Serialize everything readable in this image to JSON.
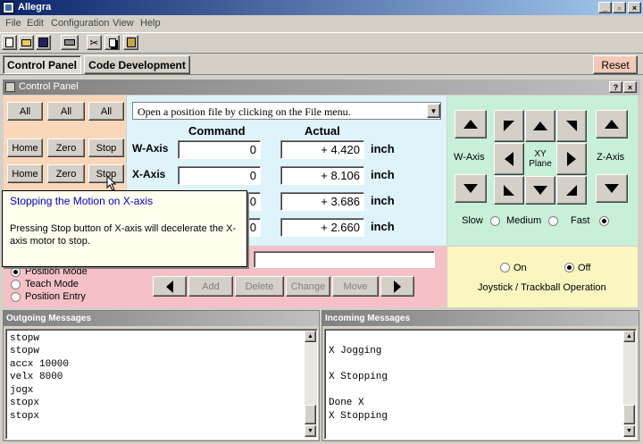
{
  "app": {
    "title": "Allegra"
  },
  "menu": [
    "File",
    "Edit",
    "Configuration",
    "View",
    "Help"
  ],
  "tabs": {
    "control_panel": "Control Panel",
    "code_development": "Code Development",
    "reset": "Reset"
  },
  "window": {
    "title": "Control Panel",
    "help": "?",
    "close": "×"
  },
  "left": {
    "all_buttons": [
      "All",
      "All",
      "All"
    ],
    "row1": [
      "Home",
      "Zero",
      "Stop"
    ],
    "row2": [
      "Home",
      "Zero",
      "Stop"
    ]
  },
  "center": {
    "dropdown_text": "Open a position file by clicking on the File menu.",
    "col_command": "Command",
    "col_actual": "Actual",
    "axes": [
      {
        "label": "W-Axis",
        "command": "0",
        "actual": "+ 4.420",
        "unit": "inch"
      },
      {
        "label": "X-Axis",
        "command": "0",
        "actual": "+ 8.106",
        "unit": "inch"
      },
      {
        "label": "",
        "command": "0",
        "actual": "+ 3.686",
        "unit": "inch"
      },
      {
        "label": "",
        "command": "0",
        "actual": "+ 2.660",
        "unit": "inch"
      }
    ]
  },
  "tooltip": {
    "title": "Stopping the Motion on X-axis",
    "body": "Pressing Stop button of X-axis will decelerate the X-axis motor to stop."
  },
  "modes": [
    "Position Mode",
    "Teach Mode",
    "Position Entry"
  ],
  "edit_buttons": [
    "Add",
    "Delete",
    "Change",
    "Move"
  ],
  "jog": {
    "w_axis": "W-Axis",
    "z_axis": "Z-Axis",
    "xy_plane": "XY\nPlane",
    "speeds": [
      {
        "label": "Slow",
        "selected": false
      },
      {
        "label": "Medium",
        "selected": false
      },
      {
        "label": "Fast",
        "selected": true
      }
    ]
  },
  "joystick": {
    "on": "On",
    "off": "Off",
    "off_selected": true,
    "caption": "Joystick / Trackball Operation"
  },
  "outgoing": {
    "title": "Outgoing Messages",
    "lines": [
      "stopw",
      "stopw",
      "accx 10000",
      "velx 8000",
      "jogx",
      "stopx",
      "stopx"
    ]
  },
  "incoming": {
    "title": "Incoming Messages",
    "lines": [
      "",
      "X Jogging",
      "",
      "X Stopping",
      "",
      "Done X",
      "X Stopping"
    ]
  },
  "colors": {
    "peach": "#fbd7b9",
    "light_blue": "#dff3fb",
    "mint": "#c8f0d8",
    "pink": "#f5c1c7",
    "yellow": "#fbf5c0",
    "tooltip_title": "#0000c0"
  }
}
